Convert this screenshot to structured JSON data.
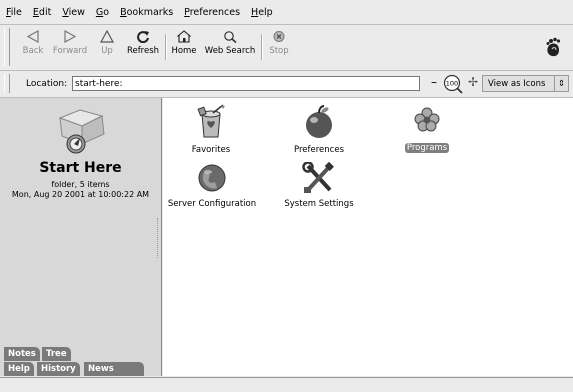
{
  "menu": [
    {
      "label": "File",
      "u": "F",
      "rest": "ile"
    },
    {
      "label": "Edit",
      "u": "E",
      "rest": "dit"
    },
    {
      "label": "View",
      "u": "V",
      "rest": "iew"
    },
    {
      "label": "Go",
      "u": "G",
      "rest": "o"
    },
    {
      "label": "Bookmarks",
      "u": "B",
      "rest": "ookmarks"
    },
    {
      "label": "Preferences",
      "u": "P",
      "rest": "references"
    },
    {
      "label": "Help",
      "u": "H",
      "rest": "elp"
    }
  ],
  "toolbar": {
    "back": "Back",
    "forward": "Forward",
    "up": "Up",
    "refresh": "Refresh",
    "home": "Home",
    "web_search": "Web Search",
    "stop": "Stop"
  },
  "location": {
    "label": "Location:",
    "value": "start-here:",
    "zoom": "100",
    "view_mode": "View as Icons"
  },
  "sidebar": {
    "title": "Start Here",
    "subtitle": "folder, 5 items",
    "date": "Mon, Aug 20 2001 at 10:00:22 AM",
    "tabs": [
      "Notes",
      "Tree",
      "Help",
      "History",
      "News"
    ]
  },
  "items": [
    {
      "label": "Favorites",
      "icon": "favorites-icon"
    },
    {
      "label": "Preferences",
      "icon": "preferences-icon"
    },
    {
      "label": "Programs",
      "icon": "programs-icon",
      "selected": true
    },
    {
      "label": "Server Configuration",
      "icon": "server-configuration-icon"
    },
    {
      "label": "System Settings",
      "icon": "system-settings-icon"
    }
  ]
}
